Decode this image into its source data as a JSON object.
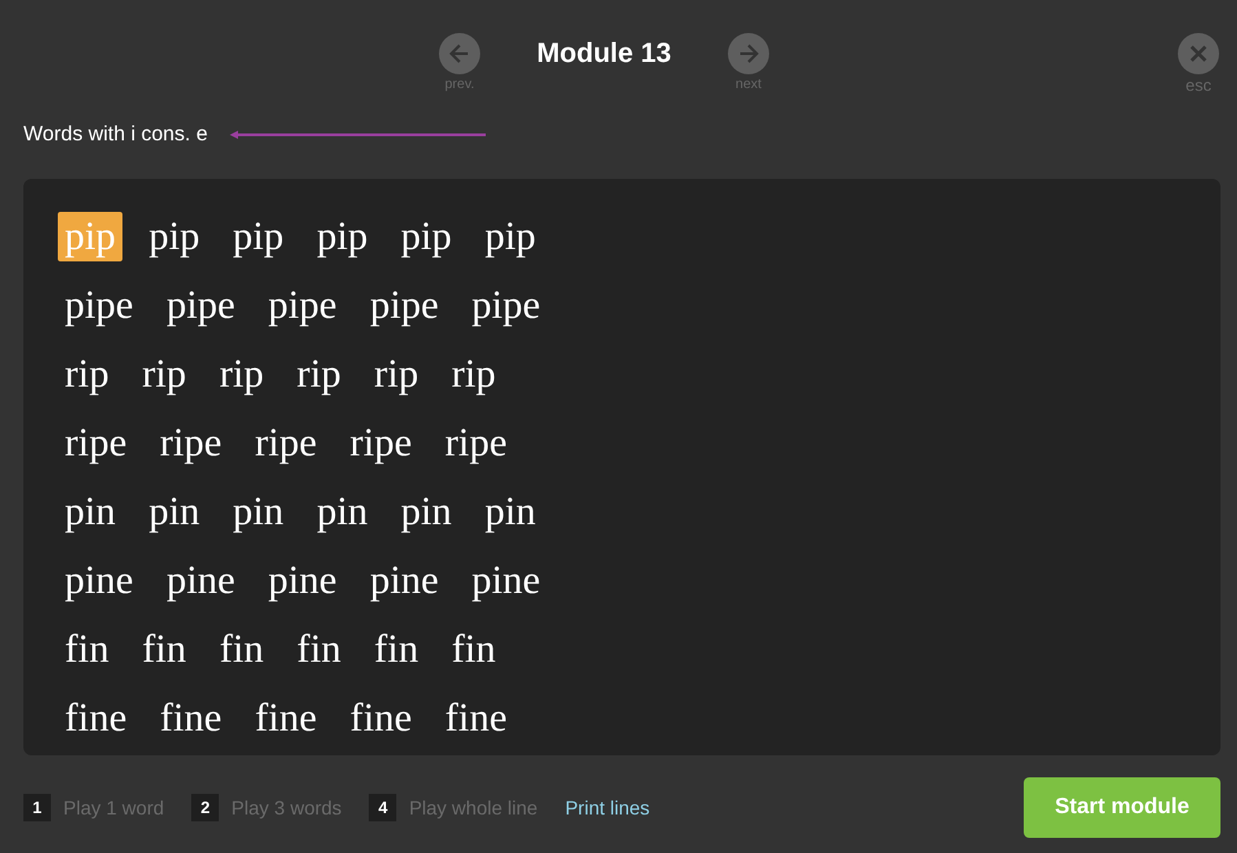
{
  "header": {
    "title": "Module 13",
    "prev_label": "prev.",
    "next_label": "next",
    "esc_label": "esc"
  },
  "subtitle": "Words with i cons. e",
  "lines": [
    [
      {
        "text": "pip",
        "selected": true
      },
      {
        "text": "pip",
        "selected": false
      },
      {
        "text": "pip",
        "selected": false
      },
      {
        "text": "pip",
        "selected": false
      },
      {
        "text": "pip",
        "selected": false
      },
      {
        "text": "pip",
        "selected": false
      }
    ],
    [
      {
        "text": "pipe",
        "selected": false
      },
      {
        "text": "pipe",
        "selected": false
      },
      {
        "text": "pipe",
        "selected": false
      },
      {
        "text": "pipe",
        "selected": false
      },
      {
        "text": "pipe",
        "selected": false
      }
    ],
    [
      {
        "text": "rip",
        "selected": false
      },
      {
        "text": "rip",
        "selected": false
      },
      {
        "text": "rip",
        "selected": false
      },
      {
        "text": "rip",
        "selected": false
      },
      {
        "text": "rip",
        "selected": false
      },
      {
        "text": "rip",
        "selected": false
      }
    ],
    [
      {
        "text": "ripe",
        "selected": false
      },
      {
        "text": "ripe",
        "selected": false
      },
      {
        "text": "ripe",
        "selected": false
      },
      {
        "text": "ripe",
        "selected": false
      },
      {
        "text": "ripe",
        "selected": false
      }
    ],
    [
      {
        "text": "pin",
        "selected": false
      },
      {
        "text": "pin",
        "selected": false
      },
      {
        "text": "pin",
        "selected": false
      },
      {
        "text": "pin",
        "selected": false
      },
      {
        "text": "pin",
        "selected": false
      },
      {
        "text": "pin",
        "selected": false
      }
    ],
    [
      {
        "text": "pine",
        "selected": false
      },
      {
        "text": "pine",
        "selected": false
      },
      {
        "text": "pine",
        "selected": false
      },
      {
        "text": "pine",
        "selected": false
      },
      {
        "text": "pine",
        "selected": false
      }
    ],
    [
      {
        "text": "fin",
        "selected": false
      },
      {
        "text": "fin",
        "selected": false
      },
      {
        "text": "fin",
        "selected": false
      },
      {
        "text": "fin",
        "selected": false
      },
      {
        "text": "fin",
        "selected": false
      },
      {
        "text": "fin",
        "selected": false
      }
    ],
    [
      {
        "text": "fine",
        "selected": false
      },
      {
        "text": "fine",
        "selected": false
      },
      {
        "text": "fine",
        "selected": false
      },
      {
        "text": "fine",
        "selected": false
      },
      {
        "text": "fine",
        "selected": false
      }
    ]
  ],
  "footer": {
    "shortcuts": [
      {
        "key": "1",
        "label": "Play 1 word"
      },
      {
        "key": "2",
        "label": "Play 3 words"
      },
      {
        "key": "4",
        "label": "Play whole line"
      }
    ],
    "link": "Print lines",
    "button": "Start module"
  }
}
